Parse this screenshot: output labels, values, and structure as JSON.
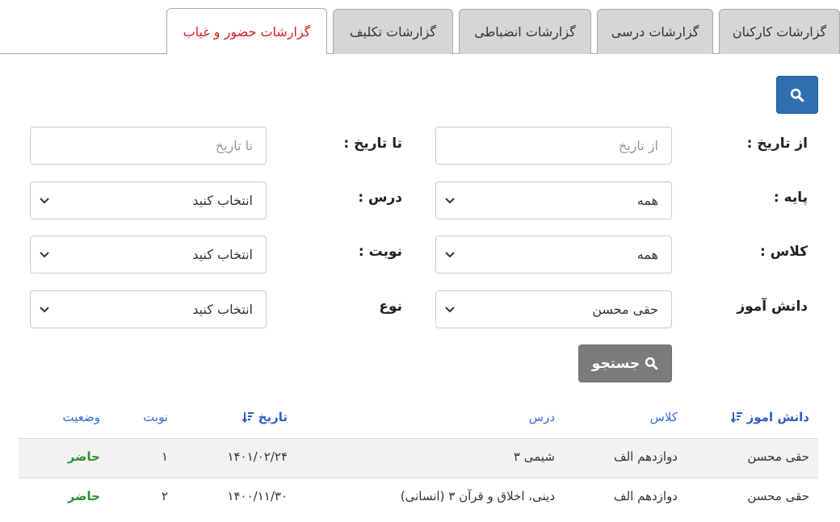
{
  "tabs": [
    {
      "label": "گزارشات کارکنان",
      "active": false
    },
    {
      "label": "گزارشات درسی",
      "active": false
    },
    {
      "label": "گزارشات انضباطی",
      "active": false
    },
    {
      "label": "گزارشات تکلیف",
      "active": false
    },
    {
      "label": "گزارشات حضور و غیاب",
      "active": true
    }
  ],
  "form": {
    "from_date_label": "از تاریخ :",
    "from_date_placeholder": "از تاریخ",
    "to_date_label": "تا تاریخ :",
    "to_date_placeholder": "تا تاریخ",
    "grade_label": "پایه :",
    "grade_value": "همه",
    "lesson_label": "درس :",
    "lesson_value": "انتخاب کنید",
    "class_label": "کلاس :",
    "class_value": "همه",
    "period_label": "نوبت :",
    "period_value": "انتخاب کنید",
    "student_label": "دانش آموز",
    "student_value": "حقی محسن",
    "type_label": "نوع",
    "type_value": "انتخاب کنید",
    "search_label": "جستجو"
  },
  "table": {
    "headers": {
      "student": "دانش اموز",
      "class": "کلاس",
      "lesson": "درس",
      "date": "تاریخ",
      "period": "نوبت",
      "status": "وضعیت"
    },
    "rows": [
      {
        "student": "حقی محسن",
        "class": "دوازدهم الف",
        "lesson": "شیمی ۳",
        "date": "۱۴۰۱/۰۲/۲۴",
        "period": "۱",
        "status": "حاضر"
      },
      {
        "student": "حقی محسن",
        "class": "دوازدهم الف",
        "lesson": "دینی، اخلاق و قرآن ۳ (انسانی)",
        "date": "۱۴۰۰/۱۱/۳۰",
        "period": "۲",
        "status": "حاضر"
      }
    ]
  },
  "colors": {
    "accent_blue": "#2e6fb0",
    "active_tab_text": "#d71f1f",
    "status_green": "#2f8f2f",
    "header_link": "#3a6fd0"
  },
  "icons": {
    "top_button": "search-icon",
    "search_button": "search-icon",
    "sort": "sort-icon",
    "select": "chevron-down-icon"
  }
}
